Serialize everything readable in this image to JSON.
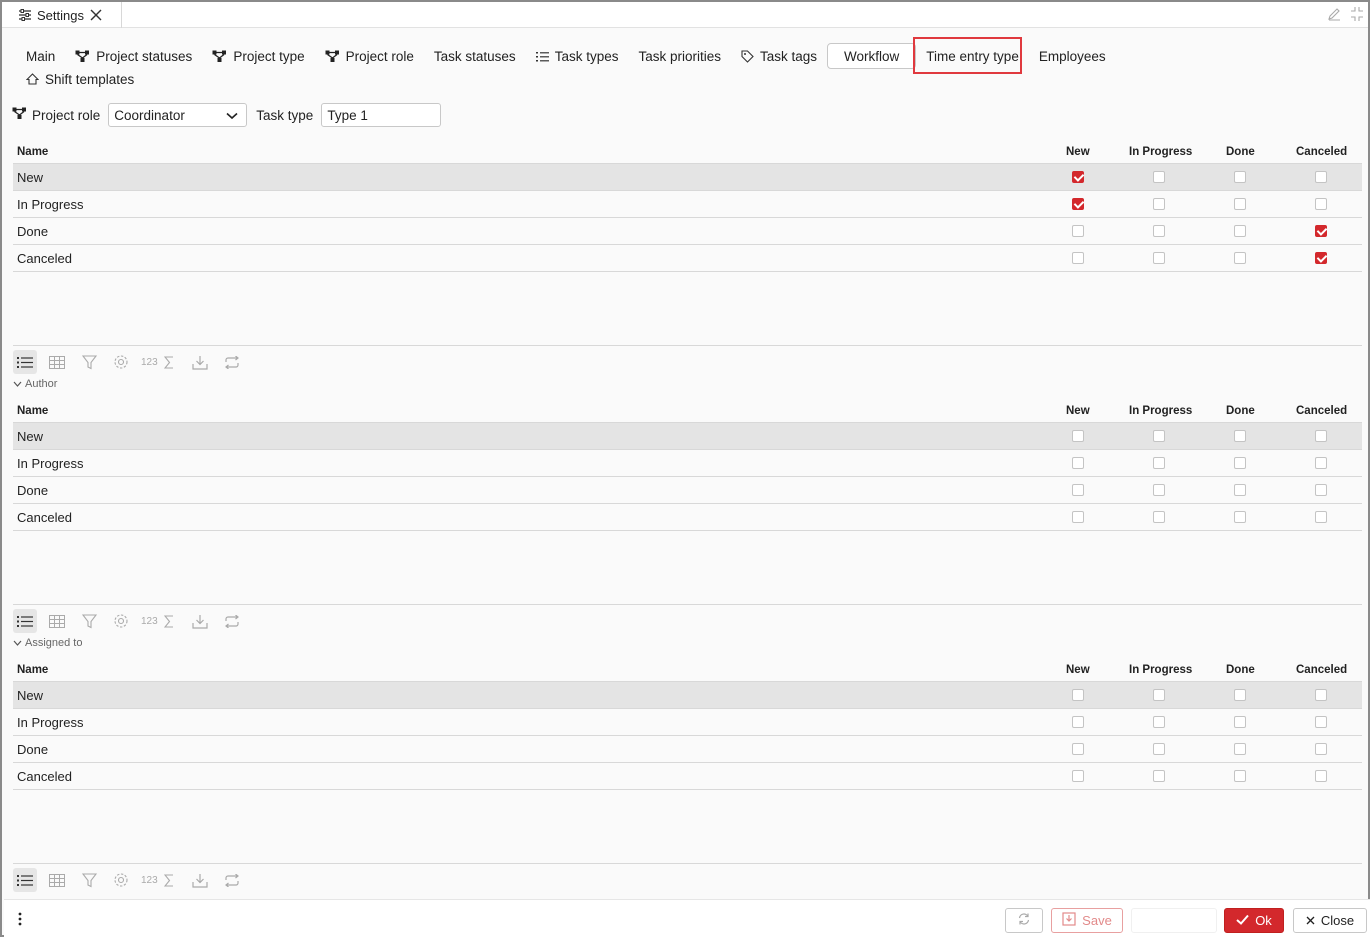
{
  "window": {
    "tab_title": "Settings"
  },
  "nav": {
    "row1": [
      {
        "label": "Main",
        "icon": "none"
      },
      {
        "label": "Project statuses",
        "icon": "hierarchy-icon"
      },
      {
        "label": "Project type",
        "icon": "hierarchy-icon"
      },
      {
        "label": "Project role",
        "icon": "hierarchy-icon"
      },
      {
        "label": "Task statuses",
        "icon": "none"
      },
      {
        "label": "Task types",
        "icon": "list-icon"
      },
      {
        "label": "Task priorities",
        "icon": "none"
      },
      {
        "label": "Task tags",
        "icon": "tag-icon"
      },
      {
        "label": "Workflow",
        "icon": "none",
        "active": true
      },
      {
        "label": "Time entry type",
        "icon": "none"
      },
      {
        "label": "Employees",
        "icon": "none"
      }
    ],
    "row2": [
      {
        "label": "Shift templates",
        "icon": "home-icon"
      }
    ]
  },
  "filters": {
    "project_role_label": "Project role",
    "project_role_value": "Coordinator",
    "task_type_label": "Task type",
    "task_type_value": "Type 1"
  },
  "columns": {
    "name": "Name",
    "new": "New",
    "in_progress": "In Progress",
    "done": "Done",
    "canceled": "Canceled"
  },
  "grids": [
    {
      "group_label": "",
      "rows": [
        {
          "name": "New",
          "checks": [
            true,
            false,
            false,
            false
          ]
        },
        {
          "name": "In Progress",
          "checks": [
            true,
            false,
            false,
            false
          ]
        },
        {
          "name": "Done",
          "checks": [
            false,
            false,
            false,
            true
          ]
        },
        {
          "name": "Canceled",
          "checks": [
            false,
            false,
            false,
            true
          ]
        }
      ]
    },
    {
      "group_label": "Author",
      "rows": [
        {
          "name": "New",
          "checks": [
            false,
            false,
            false,
            false
          ]
        },
        {
          "name": "In Progress",
          "checks": [
            false,
            false,
            false,
            false
          ]
        },
        {
          "name": "Done",
          "checks": [
            false,
            false,
            false,
            false
          ]
        },
        {
          "name": "Canceled",
          "checks": [
            false,
            false,
            false,
            false
          ]
        }
      ]
    },
    {
      "group_label": "Assigned to",
      "rows": [
        {
          "name": "New",
          "checks": [
            false,
            false,
            false,
            false
          ]
        },
        {
          "name": "In Progress",
          "checks": [
            false,
            false,
            false,
            false
          ]
        },
        {
          "name": "Done",
          "checks": [
            false,
            false,
            false,
            false
          ]
        },
        {
          "name": "Canceled",
          "checks": [
            false,
            false,
            false,
            false
          ]
        }
      ]
    }
  ],
  "toolbar": {
    "numeric_label": "123"
  },
  "footer": {
    "save_label": "Save",
    "ok_label": "Ok",
    "close_label": "Close"
  },
  "colors": {
    "accent": "#d3282c",
    "highlight_border": "#e0393e",
    "selected_row": "#e4e4e4"
  }
}
